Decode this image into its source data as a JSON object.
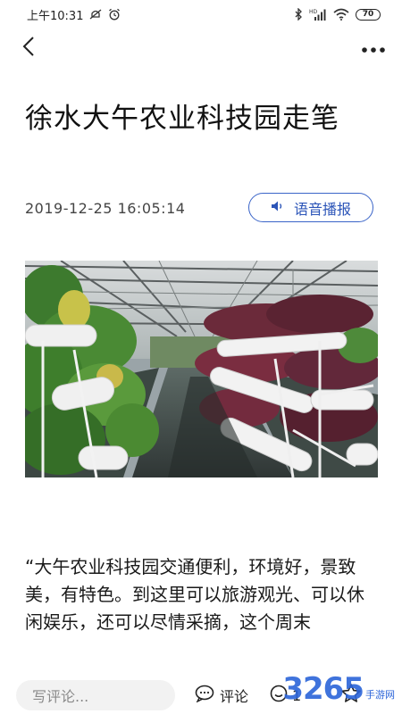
{
  "status_bar": {
    "time": "上午10:31",
    "signal_label": "HD",
    "battery": "70"
  },
  "article": {
    "title": "徐水大午农业科技园走笔",
    "time": "2019-12-25 16:05:14",
    "voice_label": "语音播报",
    "paragraph": "“大午农业科技园交通便利，环境好，景致美，有特色。到这里可以旅游观光、可以休闲娱乐，还可以尽情采摘，这个周末"
  },
  "bottom_bar": {
    "comment_placeholder": "写评论...",
    "comment_label": "评论",
    "like_count": "1"
  },
  "watermark": {
    "main": "3265",
    "sub": "手游网"
  },
  "icons": {
    "back": "back-arrow-icon",
    "more": "more-dots-icon",
    "speaker": "speaker-icon",
    "comment": "comment-bubble-icon",
    "like": "smile-icon",
    "star": "star-icon"
  },
  "colors": {
    "accent": "#2c55b8",
    "input_bg": "#f2f2f2"
  }
}
